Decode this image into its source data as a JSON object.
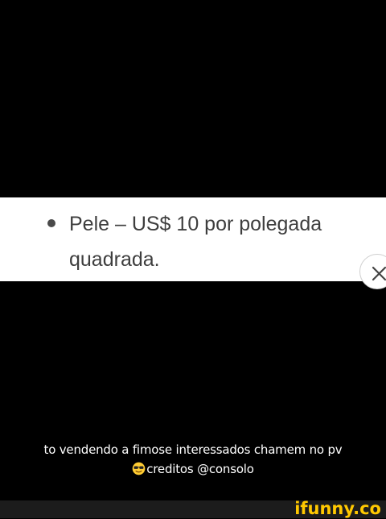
{
  "snippet": {
    "line1": "Pele – US$ 10 por polegada",
    "line2": "quadrada."
  },
  "caption": {
    "line1": "to vendendo a fimose interessados chamem no pv",
    "line2": "creditos @consolo",
    "emoji": "smiling-face-with-sunglasses"
  },
  "watermark": {
    "text": "ifunny.co"
  },
  "colors": {
    "background": "#000000",
    "snippet_background": "#ffffff",
    "snippet_text": "#3e3e3e",
    "caption_text": "#ffffff",
    "watermark": "#ffc800"
  }
}
